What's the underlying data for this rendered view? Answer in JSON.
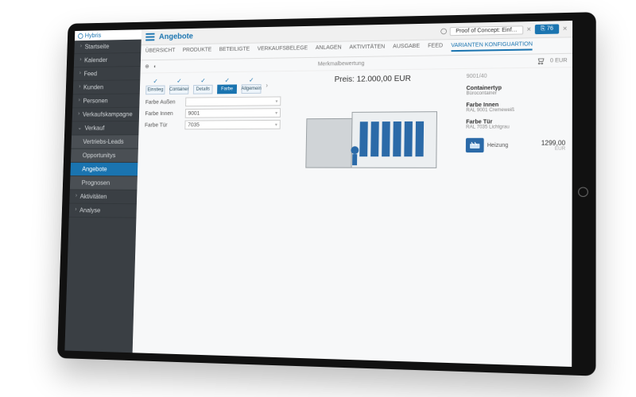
{
  "brand": "Hybris",
  "sidebar": {
    "items": [
      {
        "label": "Startseite",
        "expand": false
      },
      {
        "label": "Kalender",
        "expand": false
      },
      {
        "label": "Feed",
        "expand": false
      },
      {
        "label": "Kunden",
        "expand": true
      },
      {
        "label": "Personen",
        "expand": true
      },
      {
        "label": "Verkaufskampagne",
        "expand": true
      },
      {
        "label": "Verkauf",
        "expand": true,
        "open": true
      },
      {
        "label": "Vertriebs-Leads",
        "sub": true
      },
      {
        "label": "Opportunitys",
        "sub": true
      },
      {
        "label": "Angebote",
        "sub": true,
        "active": true
      },
      {
        "label": "Prognosen",
        "sub": true
      },
      {
        "label": "Aktivitäten",
        "expand": true
      },
      {
        "label": "Analyse",
        "expand": true
      }
    ]
  },
  "header": {
    "title": "Angebote",
    "crumb_doc": "Proof of Concept: Einf…",
    "crumb_pos_icon": "⎘",
    "crumb_pos": "76"
  },
  "tabs": [
    "ÜBERSICHT",
    "PRODUKTE",
    "BETEILIGTE",
    "VERKAUFSBELEGE",
    "ANLAGEN",
    "AKTIVITÄTEN",
    "AUSGABE",
    "FEED",
    "VARIANTEN KONFIGUARTION"
  ],
  "tabs_active": 8,
  "toolbar2": {
    "section": "Merkmalbewertung",
    "cart_total": "0 EUR"
  },
  "steps": [
    {
      "label": "Einstieg"
    },
    {
      "label": "Container"
    },
    {
      "label": "Details",
      "active": false
    },
    {
      "label": "Farbe",
      "active": true
    },
    {
      "label": "Allgemein"
    }
  ],
  "fields": [
    {
      "label": "Farbe Außen",
      "value": ""
    },
    {
      "label": "Farbe Innen",
      "value": "9001"
    },
    {
      "label": "Farbe Tür",
      "value": "7035"
    }
  ],
  "price": {
    "label": "Preis:",
    "value": "12.000,00 EUR"
  },
  "sku": "9001/40",
  "attrs": [
    {
      "k": "Containertyp",
      "v": "Bürocontainer"
    },
    {
      "k": "Farbe Innen",
      "v": "RAL 9001 Cremeweiß"
    },
    {
      "k": "Farbe Tür",
      "v": "RAL 7035 Lichtgrau"
    }
  ],
  "addon": {
    "name": "Heizung",
    "price": "1299,00",
    "cur": "EUR"
  }
}
